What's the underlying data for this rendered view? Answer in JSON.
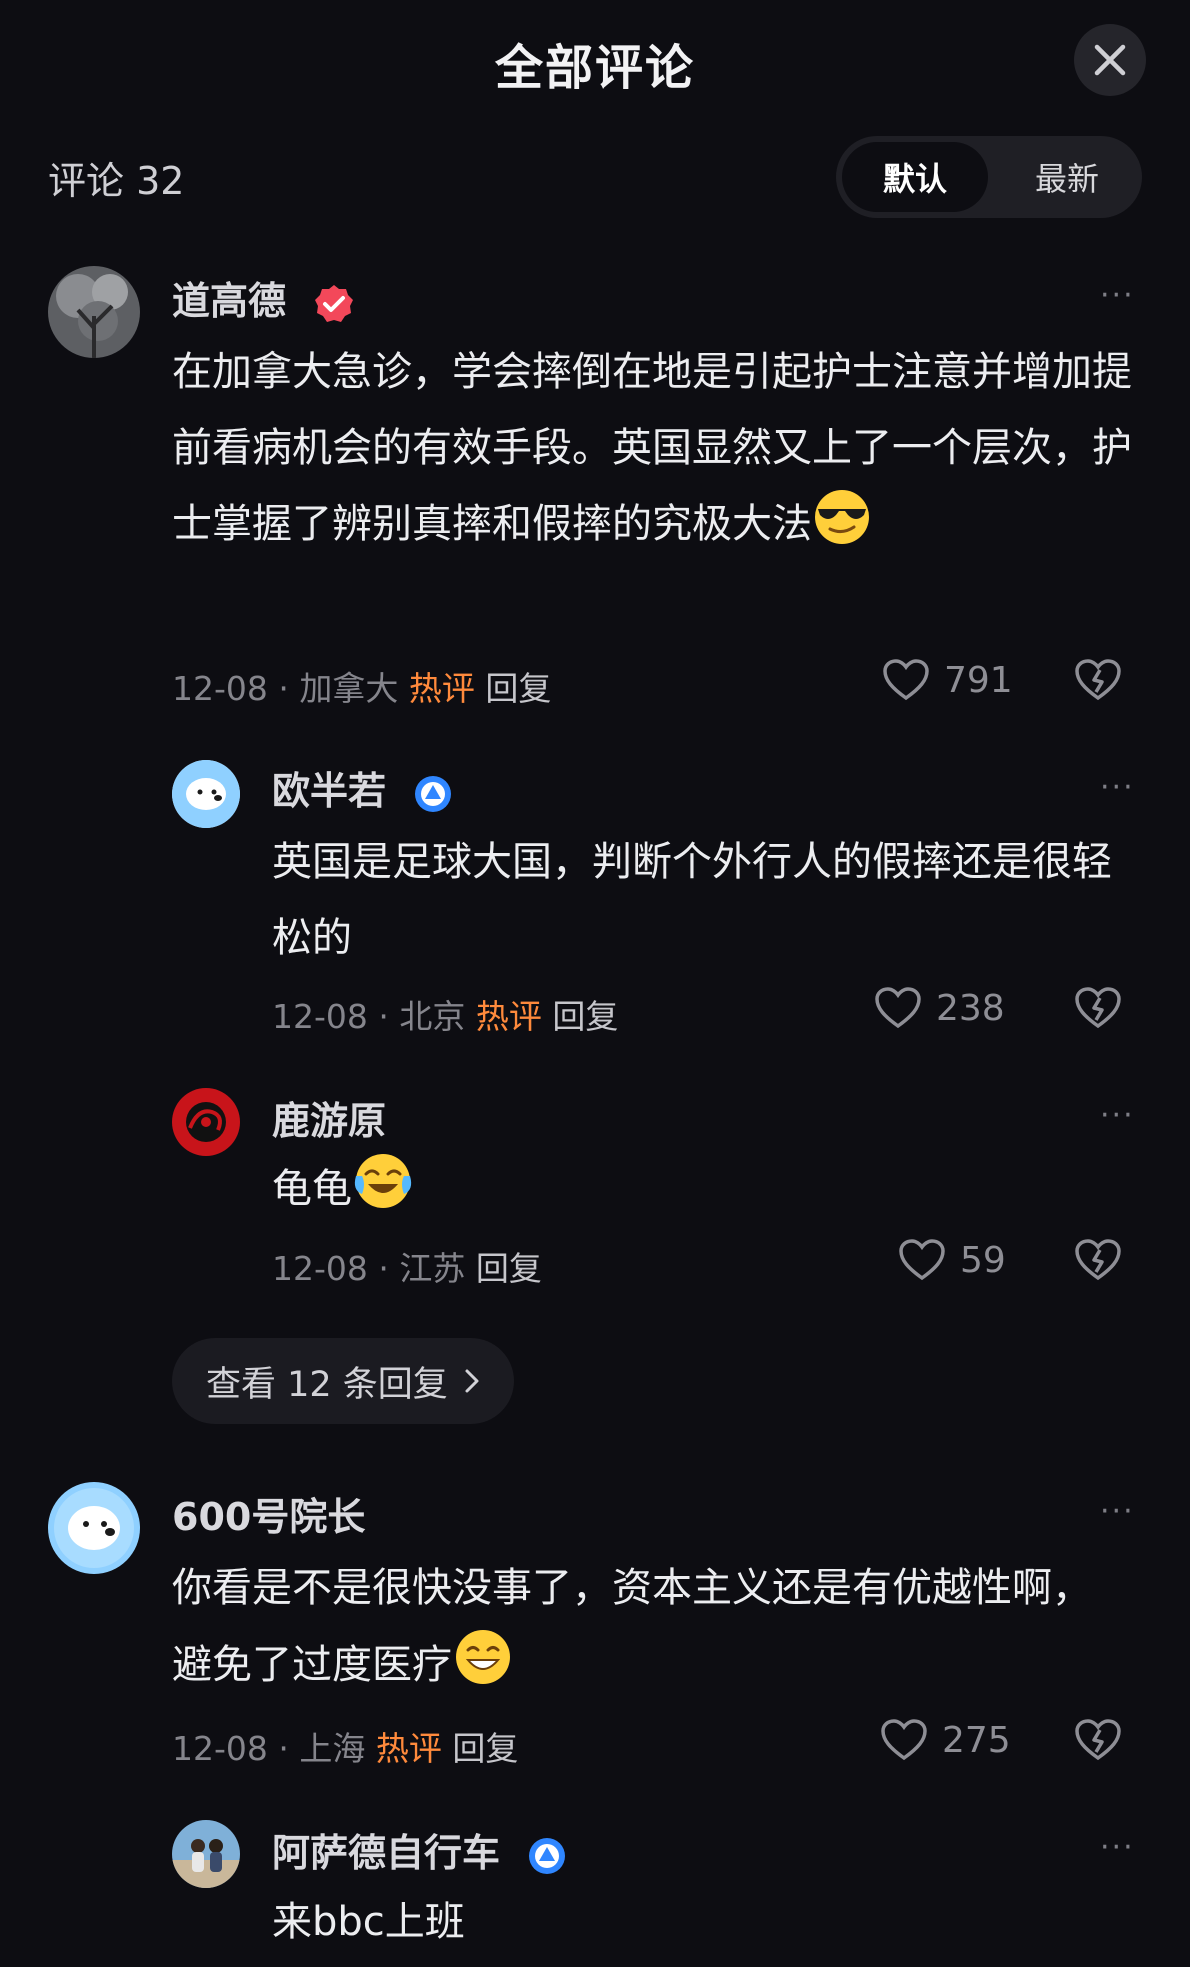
{
  "header": {
    "title": "全部评论"
  },
  "comments_count": "评论 32",
  "sort": {
    "default_label": "默认",
    "latest_label": "最新"
  },
  "comments": [
    {
      "username": "道高德",
      "text": "在加拿大急诊，学会摔倒在地是引起护士注意并增加提前看病机会的有效手段。英国显然又上了一个层次，护士掌握了辨别真摔和假摔的究极大法",
      "date": "12-08",
      "location": "加拿大",
      "hot": "热评",
      "reply_label": "回复",
      "likes": "791"
    },
    {
      "username": "欧半若",
      "text": "英国是足球大国，判断个外行人的假摔还是很轻松的",
      "date": "12-08",
      "location": "北京",
      "hot": "热评",
      "reply_label": "回复",
      "likes": "238"
    },
    {
      "username": "鹿游原",
      "text": "龟龟",
      "date": "12-08",
      "location": "江苏",
      "reply_label": "回复",
      "likes": "59"
    },
    {
      "username": "600号院长",
      "text": "你看是不是很快没事了，资本主义还是有优越性啊，避免了过度医疗",
      "date": "12-08",
      "location": "上海",
      "hot": "热评",
      "reply_label": "回复",
      "likes": "275"
    },
    {
      "username": "阿萨德自行车",
      "text": "来bbc上班"
    }
  ],
  "view_replies_label": "查看 12 条回复",
  "more_label": "···",
  "icons": {
    "close": "close-icon",
    "like": "heart-icon",
    "dislike": "broken-heart-icon",
    "verified": "verified-badge-icon",
    "more": "more-icon",
    "chevron": "chevron-right-icon"
  },
  "colors": {
    "background": "#0d0d12",
    "hot": "#ff8a3c",
    "muted": "#85858c"
  }
}
